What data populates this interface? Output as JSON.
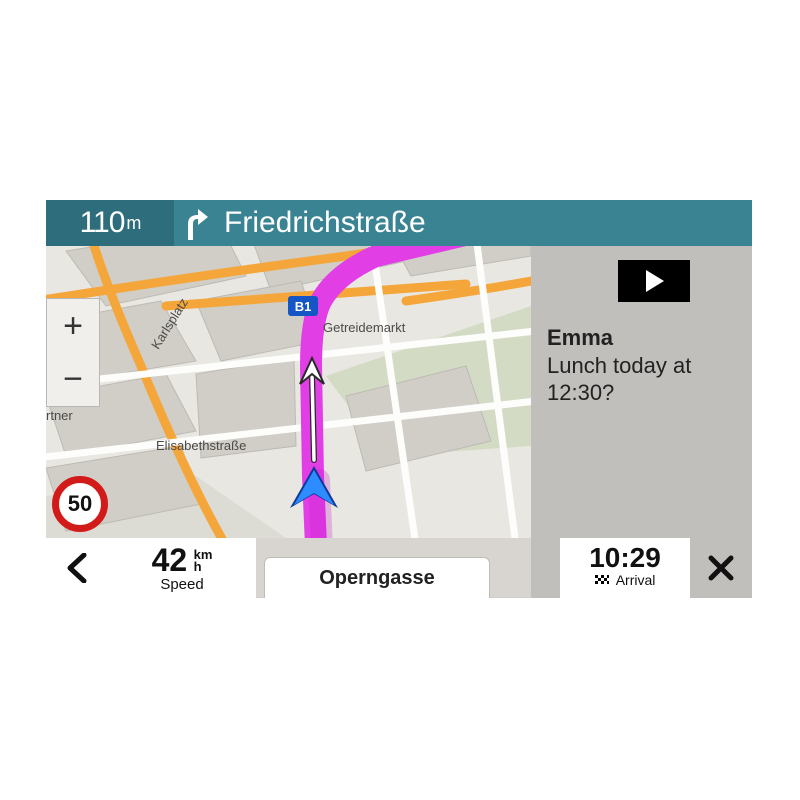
{
  "turn": {
    "distance_value": "110",
    "distance_unit": "m",
    "street": "Friedrichstraße"
  },
  "notification": {
    "sender": "Emma",
    "message": "Lunch today at 12:30?"
  },
  "map": {
    "current_street": "Operngasse",
    "route_badge": "B1",
    "labels": {
      "karlsplatz": "Karlsplatz",
      "getreidemarkt": "Getreidemarkt",
      "elisabethstrasse": "Elisabethstraße",
      "rtner": "rtner"
    }
  },
  "zoom": {
    "in": "+",
    "out": "−"
  },
  "speed_limit": "50",
  "status": {
    "speed_value": "42",
    "speed_unit_top": "km",
    "speed_unit_bottom": "h",
    "speed_label": "Speed",
    "arrival_time": "10:29",
    "arrival_label": "Arrival"
  },
  "colors": {
    "header_dark": "#2d6d7c",
    "header_light": "#3a8393",
    "route": "#e23ee6",
    "arterial": "#f4a63a"
  }
}
